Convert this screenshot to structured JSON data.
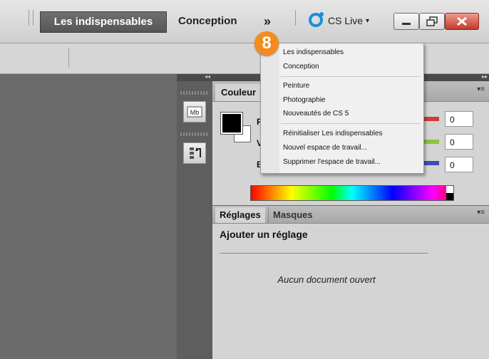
{
  "topbar": {
    "workspaces": [
      "Les indispensables",
      "Conception"
    ],
    "more": "»",
    "cslive": {
      "label": "CS Live",
      "caret": "▾",
      "icon": "cs-live-icon"
    },
    "window_buttons": [
      "minimize-icon",
      "restore-icon",
      "close-icon"
    ],
    "colors": {
      "active_tab": "#5f5f5f",
      "close": "#c23a2a"
    }
  },
  "dock": {
    "collapse_left": "◂◂",
    "collapse_right": "▸▸"
  },
  "tools": [
    "paragraph-style-icon",
    "history-icon"
  ],
  "color_panel": {
    "tab": "Couleur",
    "menu_icon": "▾≡",
    "channels": [
      {
        "label": "R",
        "value": "0",
        "color": "#d23a3a"
      },
      {
        "label": "V",
        "value": "0",
        "color": "#8ac43f"
      },
      {
        "label": "B",
        "value": "0",
        "color": "#3a4fb0"
      }
    ],
    "foreground": "#000000",
    "background": "#ffffff"
  },
  "adjustments_panel": {
    "tabs": [
      "Réglages",
      "Masques"
    ],
    "menu_icon": "▾≡",
    "heading": "Ajouter un réglage",
    "empty_message": "Aucun document ouvert"
  },
  "workspace_menu": {
    "groups": [
      [
        "Les indispensables",
        "Conception"
      ],
      [
        "Peinture",
        "Photographie",
        "Nouveautés de CS 5"
      ],
      [
        "Réinitialiser Les indispensables",
        "Nouvel espace de travail...",
        "Supprimer l'espace de travail..."
      ]
    ]
  },
  "step_badge": "8"
}
